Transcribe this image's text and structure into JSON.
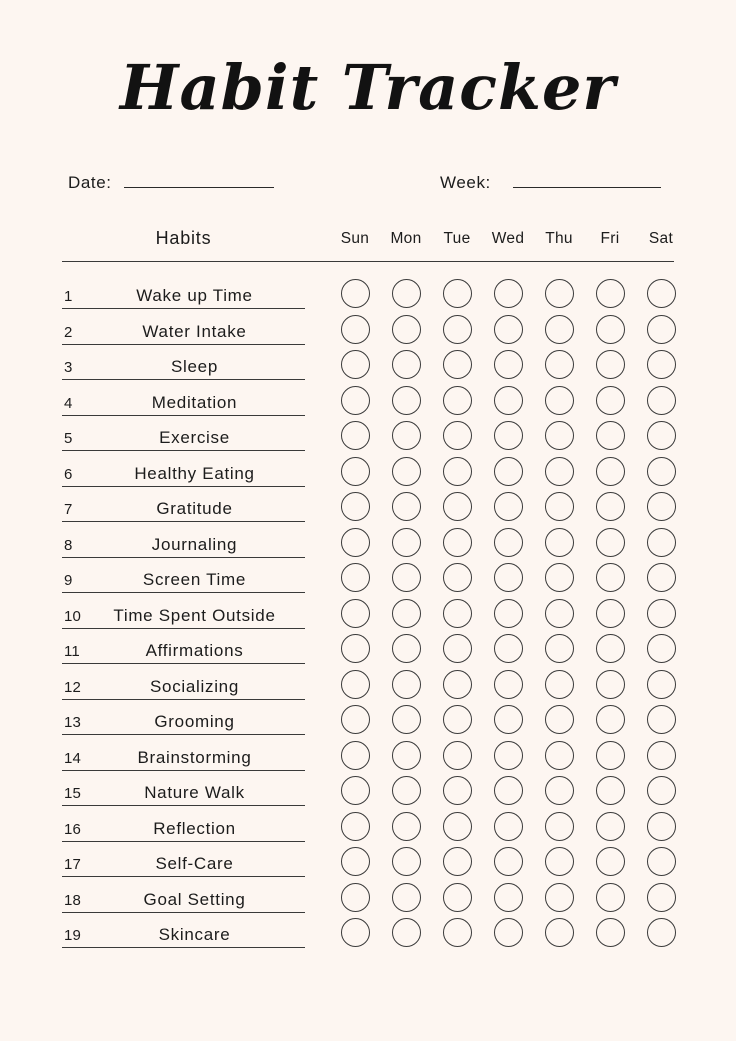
{
  "page": {
    "background_color": "#fdf6f1",
    "ink_color": "#1c1c1c",
    "rule_color": "#3a3a3a"
  },
  "header": {
    "title": "Habit Tracker"
  },
  "meta": {
    "date_label": "Date:",
    "date_value": "",
    "week_label": "Week:",
    "week_value": ""
  },
  "table": {
    "habits_header": "Habits",
    "day_headers": [
      "Sun",
      "Mon",
      "Tue",
      "Wed",
      "Thu",
      "Fri",
      "Sat"
    ],
    "rows": [
      {
        "num": "1",
        "name": "Wake up Time"
      },
      {
        "num": "2",
        "name": "Water Intake"
      },
      {
        "num": "3",
        "name": "Sleep"
      },
      {
        "num": "4",
        "name": "Meditation"
      },
      {
        "num": "5",
        "name": "Exercise"
      },
      {
        "num": "6",
        "name": "Healthy Eating"
      },
      {
        "num": "7",
        "name": "Gratitude"
      },
      {
        "num": "8",
        "name": "Journaling"
      },
      {
        "num": "9",
        "name": "Screen Time"
      },
      {
        "num": "10",
        "name": "Time Spent Outside"
      },
      {
        "num": "11",
        "name": "Affirmations"
      },
      {
        "num": "12",
        "name": "Socializing"
      },
      {
        "num": "13",
        "name": "Grooming"
      },
      {
        "num": "14",
        "name": "Brainstorming"
      },
      {
        "num": "15",
        "name": "Nature Walk"
      },
      {
        "num": "16",
        "name": "Reflection"
      },
      {
        "num": "17",
        "name": "Self-Care"
      },
      {
        "num": "18",
        "name": "Goal Setting"
      },
      {
        "num": "19",
        "name": "Skincare"
      }
    ]
  }
}
